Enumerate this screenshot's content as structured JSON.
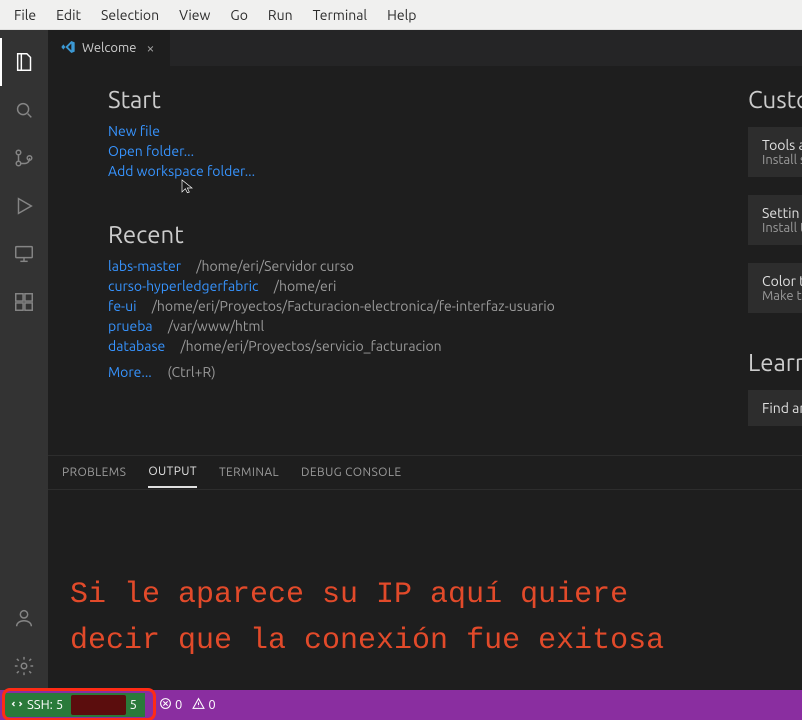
{
  "menubar": [
    "File",
    "Edit",
    "Selection",
    "View",
    "Go",
    "Run",
    "Terminal",
    "Help"
  ],
  "activitybar": {
    "icons": [
      "files-icon",
      "search-icon",
      "source-control-icon",
      "debug-icon",
      "remote-explorer-icon",
      "extensions-icon",
      "account-icon",
      "settings-gear-icon"
    ]
  },
  "tab": {
    "title": "Welcome"
  },
  "welcome": {
    "start_heading": "Start",
    "start_new_file": "New file",
    "start_open_folder": "Open folder...",
    "start_add_workspace": "Add workspace folder...",
    "recent_heading": "Recent",
    "recent": [
      {
        "name": "labs-master",
        "path": "/home/eri/Servidor curso"
      },
      {
        "name": "curso-hyperledgerfabric",
        "path": "/home/eri"
      },
      {
        "name": "fe-ui",
        "path": "/home/eri/Proyectos/Facturacion-electronica/fe-interfaz-usuario"
      },
      {
        "name": "prueba",
        "path": "/var/www/html"
      },
      {
        "name": "database",
        "path": "/home/eri/Proyectos/servicio_facturacion"
      }
    ],
    "more": "More...",
    "more_hint": "(Ctrl+R)",
    "customize_heading": "Custom",
    "card_tools_title": "Tools a",
    "card_tools_sub": "Install s",
    "card_settings_title": "Settin",
    "card_settings_sub": "Install t",
    "card_color_title": "Color t",
    "card_color_sub": "Make t",
    "learn_heading": "Learn",
    "learn_find": "Find an"
  },
  "panel": {
    "tabs": [
      "PROBLEMS",
      "OUTPUT",
      "TERMINAL",
      "DEBUG CONSOLE"
    ],
    "active_index": 1
  },
  "annotation": {
    "line1": "Si le aparece su IP aquí quiere",
    "line2": "decir que la conexión fue exitosa"
  },
  "statusbar": {
    "ssh_prefix": "SSH: 5",
    "ssh_suffix": "5",
    "errors": "0",
    "warnings": "0"
  }
}
